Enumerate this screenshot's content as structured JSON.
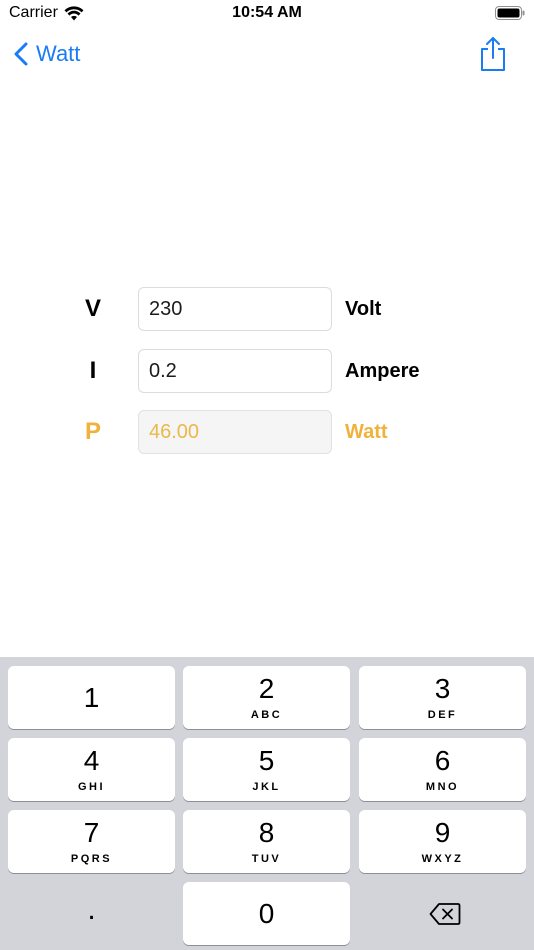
{
  "status_bar": {
    "carrier": "Carrier",
    "time": "10:54 AM"
  },
  "nav": {
    "back_label": "Watt",
    "back_icon": "chevron-left-icon",
    "share_icon": "share-icon"
  },
  "form": {
    "voltage": {
      "symbol": "V",
      "value": "230",
      "unit": "Volt"
    },
    "current": {
      "symbol": "I",
      "value": "0.2",
      "unit": "Ampere"
    },
    "power": {
      "symbol": "P",
      "value": "46.00",
      "unit": "Watt"
    }
  },
  "keyboard": {
    "keys": [
      {
        "digit": "1",
        "letters": ""
      },
      {
        "digit": "2",
        "letters": "ABC"
      },
      {
        "digit": "3",
        "letters": "DEF"
      },
      {
        "digit": "4",
        "letters": "GHI"
      },
      {
        "digit": "5",
        "letters": "JKL"
      },
      {
        "digit": "6",
        "letters": "MNO"
      },
      {
        "digit": "7",
        "letters": "PQRS"
      },
      {
        "digit": "8",
        "letters": "TUV"
      },
      {
        "digit": "9",
        "letters": "WXYZ"
      }
    ],
    "decimal": ".",
    "zero": "0",
    "delete_icon": "delete-backward-icon"
  },
  "colors": {
    "accent": "#f0b23a",
    "link": "#1a7cf5",
    "keyboard_bg": "#d2d4da"
  }
}
